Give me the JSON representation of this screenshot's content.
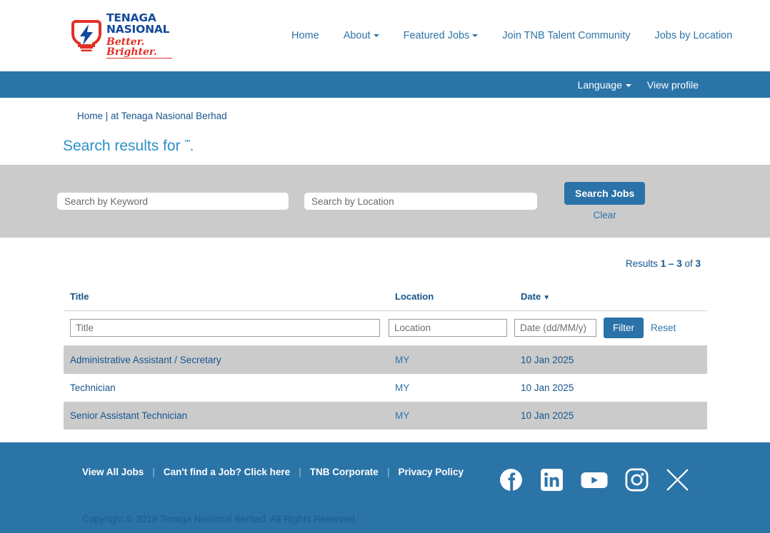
{
  "brand": {
    "name_line1": "TENAGA",
    "name_line2": "NASIONAL",
    "tagline": "Better. Brighter.",
    "logo_icon": "tnb-lightbulb-logo",
    "blue": "#14499b",
    "red": "#e03127"
  },
  "nav": {
    "items": [
      {
        "label": "Home",
        "has_caret": false
      },
      {
        "label": "About",
        "has_caret": true
      },
      {
        "label": "Featured Jobs",
        "has_caret": true
      },
      {
        "label": "Join TNB Talent Community",
        "has_caret": false
      },
      {
        "label": "Jobs by Location",
        "has_caret": false
      }
    ]
  },
  "utility_bar": {
    "language_label": "Language",
    "view_profile_label": "View profile",
    "background": "#2b74a8"
  },
  "breadcrumb": {
    "text": "Home | at Tenaga Nasional Berhad"
  },
  "page_title": {
    "prefix": "Search results for ",
    "query": "\"\"",
    "suffix": "."
  },
  "search_panel": {
    "keyword_placeholder": "Search by Keyword",
    "keyword_value": "",
    "location_placeholder": "Search by Location",
    "location_value": "",
    "search_button_label": "Search Jobs",
    "clear_label": "Clear",
    "background": "#cbcbcb",
    "button_color": "#2a72a8"
  },
  "results": {
    "count_prefix": "Results ",
    "count_range": "1 – 3",
    "count_middle": " of ",
    "count_total": "3",
    "columns": {
      "title": "Title",
      "location": "Location",
      "date": "Date",
      "date_sort_arrow": "▼"
    },
    "filters": {
      "title_placeholder": "Title",
      "title_value": "",
      "location_placeholder": "Location",
      "location_value": "",
      "date_placeholder": "Date (dd/MM/y)",
      "date_value": "",
      "filter_button_label": "Filter",
      "reset_label": "Reset"
    },
    "rows": [
      {
        "title": "Administrative Assistant / Secretary",
        "location": "MY",
        "date": "10 Jan 2025"
      },
      {
        "title": "Technician",
        "location": "MY",
        "date": "10 Jan 2025"
      },
      {
        "title": "Senior Assistant Technician",
        "location": "MY",
        "date": "10 Jan 2025"
      }
    ]
  },
  "footer": {
    "links": [
      "View All Jobs",
      "Can't find a Job? Click here",
      "TNB Corporate",
      "Privacy Policy"
    ],
    "separator": "|",
    "socials": [
      "facebook-icon",
      "linkedin-icon",
      "youtube-icon",
      "instagram-icon",
      "x-twitter-icon"
    ],
    "copyright": "Copyright © 2018 Tenaga Nasional Berhad. All Rights Reserved.",
    "background": "#2b74a8"
  }
}
